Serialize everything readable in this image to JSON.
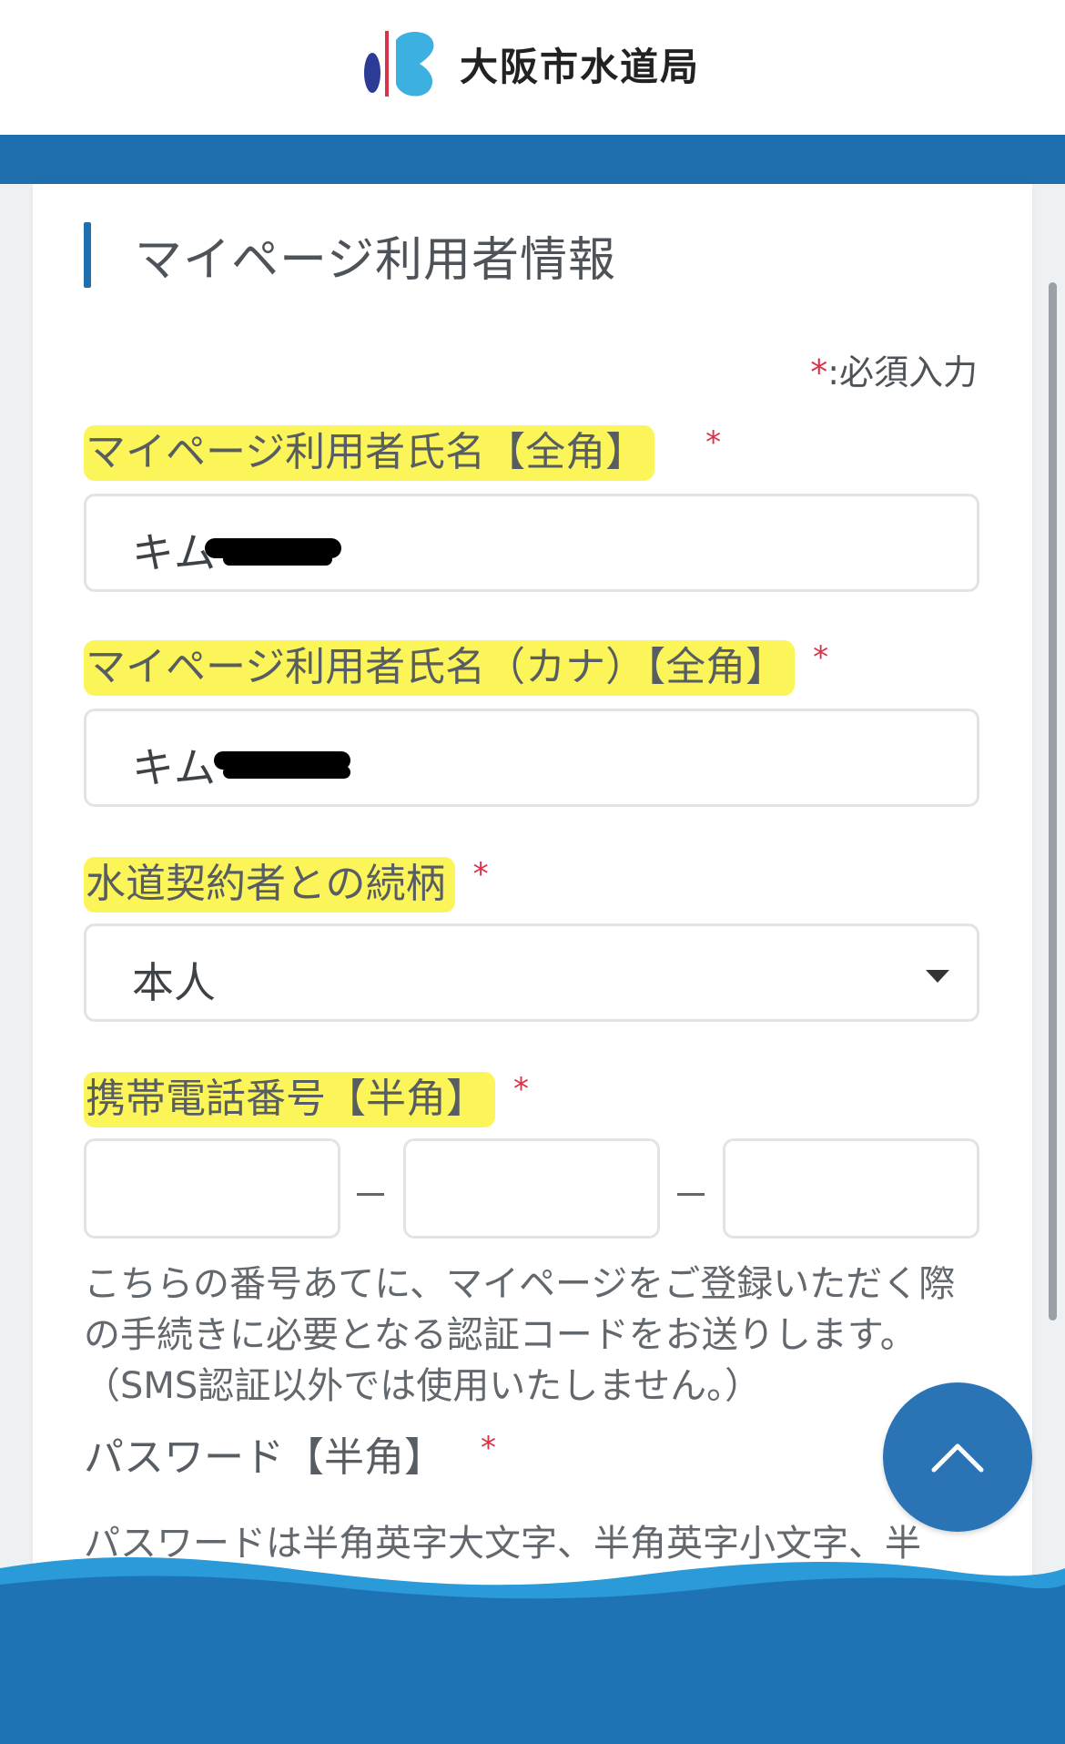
{
  "header": {
    "logo_text": "大阪市水道局",
    "accent_color": "#1f6fae"
  },
  "section": {
    "title": "マイページ利用者情報",
    "required_note_mark": "*",
    "required_note_text": ":必須入力"
  },
  "fields": {
    "name": {
      "label": "マイページ利用者氏名【全角】",
      "required_mark": "*",
      "value_visible": "キム"
    },
    "kana": {
      "label": "マイページ利用者氏名（カナ）【全角】",
      "required_mark": "*",
      "value_visible": "キム"
    },
    "relation": {
      "label": "水道契約者との続柄",
      "required_mark": "*",
      "selected": "本人"
    },
    "phone": {
      "label": "携帯電話番号【半角】",
      "required_mark": "*",
      "help_text": "こちらの番号あてに、マイページをご登録いただく際の手続きに必要となる認証コードをお送りします。（SMS認証以外では使用いたしません。）"
    },
    "password": {
      "label": "パスワード【半角】",
      "required_mark": "*",
      "description": "パスワードは半角英字大文字、半角英字小文字、半"
    }
  },
  "icons": {
    "logo": "osaka-waterworks-logo-icon",
    "caret": "chevron-down-icon",
    "to_top": "chevron-up-icon"
  }
}
